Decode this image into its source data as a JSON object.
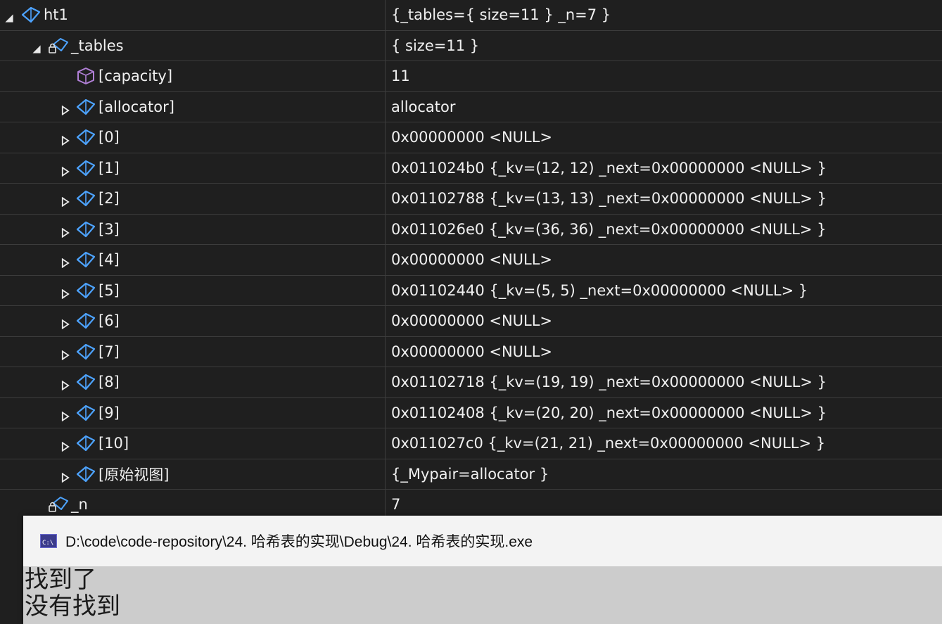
{
  "watch": {
    "rows": [
      {
        "name": "ht1",
        "value": "{_tables={ size=11 } _n=7 }",
        "depth": 0,
        "expander": "expanded",
        "icon": "object-icon"
      },
      {
        "name": "_tables",
        "value": "{ size=11 }",
        "depth": 1,
        "expander": "expanded",
        "icon": "private-object-icon"
      },
      {
        "name": "[capacity]",
        "value": "11",
        "depth": 2,
        "expander": "none",
        "icon": "property-cube-icon"
      },
      {
        "name": "[allocator]",
        "value": "allocator",
        "depth": 2,
        "expander": "collapsed",
        "icon": "object-icon"
      },
      {
        "name": "[0]",
        "value": "0x00000000 <NULL>",
        "depth": 2,
        "expander": "collapsed",
        "icon": "object-icon"
      },
      {
        "name": "[1]",
        "value": "0x011024b0 {_kv=(12, 12) _next=0x00000000 <NULL> }",
        "depth": 2,
        "expander": "collapsed",
        "icon": "object-icon"
      },
      {
        "name": "[2]",
        "value": "0x01102788 {_kv=(13, 13) _next=0x00000000 <NULL> }",
        "depth": 2,
        "expander": "collapsed",
        "icon": "object-icon"
      },
      {
        "name": "[3]",
        "value": "0x011026e0 {_kv=(36, 36) _next=0x00000000 <NULL> }",
        "depth": 2,
        "expander": "collapsed",
        "icon": "object-icon"
      },
      {
        "name": "[4]",
        "value": "0x00000000 <NULL>",
        "depth": 2,
        "expander": "collapsed",
        "icon": "object-icon"
      },
      {
        "name": "[5]",
        "value": "0x01102440 {_kv=(5, 5) _next=0x00000000 <NULL> }",
        "depth": 2,
        "expander": "collapsed",
        "icon": "object-icon"
      },
      {
        "name": "[6]",
        "value": "0x00000000 <NULL>",
        "depth": 2,
        "expander": "collapsed",
        "icon": "object-icon"
      },
      {
        "name": "[7]",
        "value": "0x00000000 <NULL>",
        "depth": 2,
        "expander": "collapsed",
        "icon": "object-icon"
      },
      {
        "name": "[8]",
        "value": "0x01102718 {_kv=(19, 19) _next=0x00000000 <NULL> }",
        "depth": 2,
        "expander": "collapsed",
        "icon": "object-icon"
      },
      {
        "name": "[9]",
        "value": "0x01102408 {_kv=(20, 20) _next=0x00000000 <NULL> }",
        "depth": 2,
        "expander": "collapsed",
        "icon": "object-icon"
      },
      {
        "name": "[10]",
        "value": "0x011027c0 {_kv=(21, 21) _next=0x00000000 <NULL> }",
        "depth": 2,
        "expander": "collapsed",
        "icon": "object-icon"
      },
      {
        "name": "[原始视图]",
        "value": "{_Mypair=allocator }",
        "depth": 2,
        "expander": "collapsed",
        "icon": "object-icon"
      },
      {
        "name": "_n",
        "value": "7",
        "depth": 1,
        "expander": "none",
        "icon": "private-object-icon"
      }
    ]
  },
  "console": {
    "app_icon_text": "C:\\",
    "title": "D:\\code\\code-repository\\24. 哈希表的实现\\Debug\\24. 哈希表的实现.exe",
    "lines": [
      "找到了",
      "没有找到"
    ]
  },
  "colors": {
    "object_icon": "#4da3ff",
    "property_icon": "#b180d7",
    "watch_bg": "#1f1f1f",
    "console_bg": "#cccccc"
  }
}
